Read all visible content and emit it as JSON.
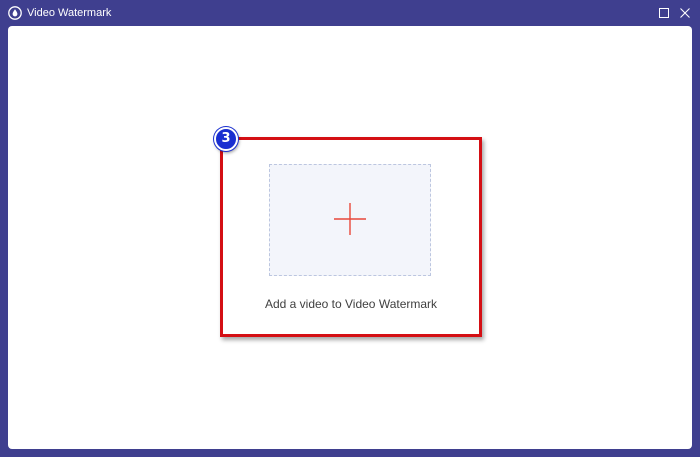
{
  "window": {
    "title": "Video Watermark",
    "app_icon": "watermark-drop-icon",
    "controls": {
      "maximize_icon": "maximize-icon",
      "close_icon": "close-icon"
    }
  },
  "main": {
    "step_badge": "3",
    "drop_zone": {
      "icon": "plus-icon",
      "label": "Add a video to Video Watermark"
    }
  },
  "colors": {
    "titlebar": "#3f3f8f",
    "highlight_frame": "#d40f14",
    "step_badge": "#1a2fd0",
    "plus": "#e8473a",
    "drop_zone_bg": "#f3f5fb"
  }
}
